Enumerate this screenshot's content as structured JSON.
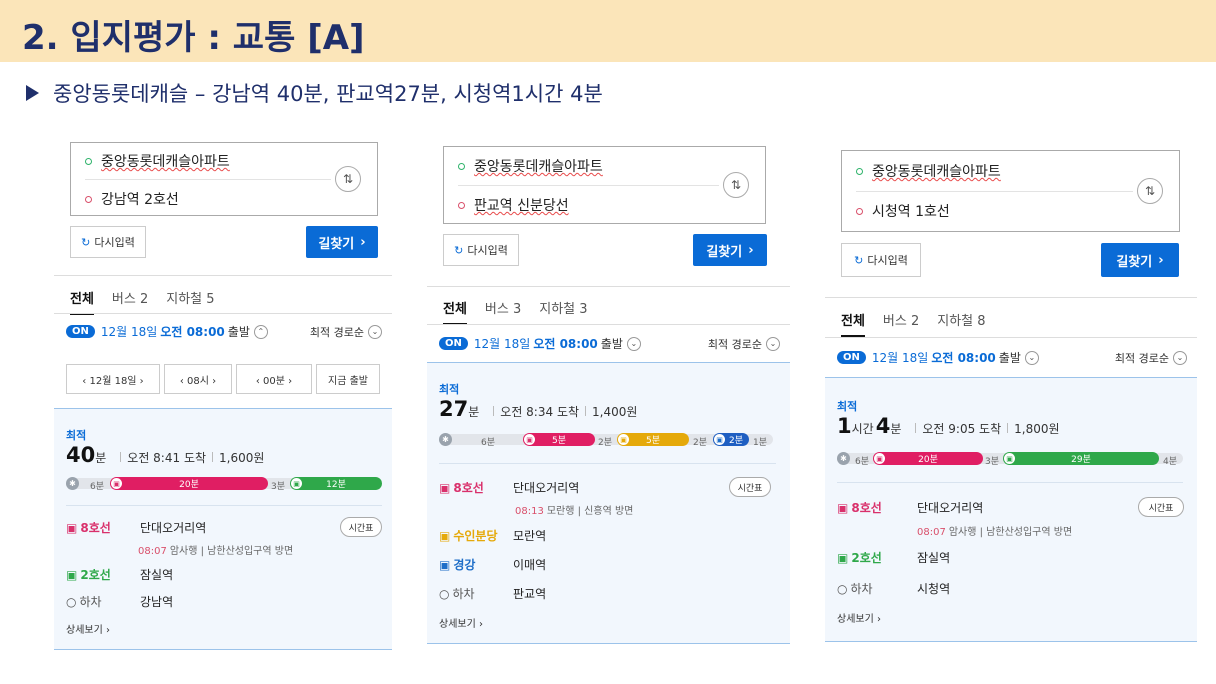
{
  "title": "2. 입지평가 : 교통 [A]",
  "subtitle": "중앙동롯데캐슬 – 강남역 40분, 판교역27분, 시청역1시간 4분",
  "panels": [
    {
      "origin": "중앙동롯데캐슬아파트",
      "dest": "강남역 2호선",
      "reset": "다시입력",
      "find": "길찾기",
      "tabs": [
        "전체",
        "버스 2",
        "지하철 5"
      ],
      "on": "ON",
      "date": "12월 18일",
      "time": "오전 08:00",
      "depart": "출발",
      "sort": "최적 경로순",
      "ctl": [
        "‹  12월 18일  ›",
        "‹  08시  ›",
        "‹  00분  ›",
        "지금 출발"
      ],
      "best": "최적",
      "dur_main": "40",
      "dur_unit": "분",
      "arrive": "오전 8:41 도착",
      "fare": "1,600원",
      "segs": {
        "w1": "6분",
        "s1": "20분",
        "w2": "3분",
        "s2": "12분"
      },
      "steps": [
        {
          "line": "8호선",
          "stn": "단대오거리역",
          "sub_t": "08:07",
          "sub_d": "암사행",
          "sub_dir": "남한산성입구역 방면"
        },
        {
          "line": "2호선",
          "stn": "잠실역"
        },
        {
          "line": "하차",
          "stn": "강남역"
        }
      ],
      "tt": "시간표",
      "more": "상세보기 ›"
    },
    {
      "origin": "중앙동롯데캐슬아파트",
      "dest": "판교역 신분당선",
      "reset": "다시입력",
      "find": "길찾기",
      "tabs": [
        "전체",
        "버스 3",
        "지하철 3"
      ],
      "on": "ON",
      "date": "12월 18일",
      "time": "오전 08:00",
      "depart": "출발",
      "sort": "최적 경로순",
      "best": "최적",
      "dur_main": "27",
      "dur_unit": "분",
      "arrive": "오전 8:34 도착",
      "fare": "1,400원",
      "segs": {
        "w1": "6분",
        "s1": "5분",
        "w2": "2분",
        "s2": "5분",
        "w3": "2분",
        "s3": "2분",
        "w4": "1분"
      },
      "steps": [
        {
          "line": "8호선",
          "stn": "단대오거리역",
          "sub_t": "08:13",
          "sub_d": "모란행",
          "sub_dir": "신흥역 방면"
        },
        {
          "line": "수인분당",
          "stn": "모란역"
        },
        {
          "line": "경강",
          "stn": "이매역"
        },
        {
          "line": "하차",
          "stn": "판교역"
        }
      ],
      "tt": "시간표",
      "more": "상세보기 ›"
    },
    {
      "origin": "중앙동롯데캐슬아파트",
      "dest": "시청역 1호선",
      "reset": "다시입력",
      "find": "길찾기",
      "tabs": [
        "전체",
        "버스 2",
        "지하철 8"
      ],
      "on": "ON",
      "date": "12월 18일",
      "time": "오전 08:00",
      "depart": "출발",
      "sort": "최적 경로순",
      "best": "최적",
      "dur_h": "1",
      "dur_hu": "시간",
      "dur_main": "4",
      "dur_unit": "분",
      "arrive": "오전 9:05 도착",
      "fare": "1,800원",
      "segs": {
        "w1": "6분",
        "s1": "20분",
        "w2": "3분",
        "s2": "29분",
        "w3": "4분"
      },
      "steps": [
        {
          "line": "8호선",
          "stn": "단대오거리역",
          "sub_t": "08:07",
          "sub_d": "암사행",
          "sub_dir": "남한산성입구역 방면"
        },
        {
          "line": "2호선",
          "stn": "잠실역"
        },
        {
          "line": "하차",
          "stn": "시청역"
        }
      ],
      "tt": "시간표",
      "more": "상세보기 ›"
    }
  ]
}
